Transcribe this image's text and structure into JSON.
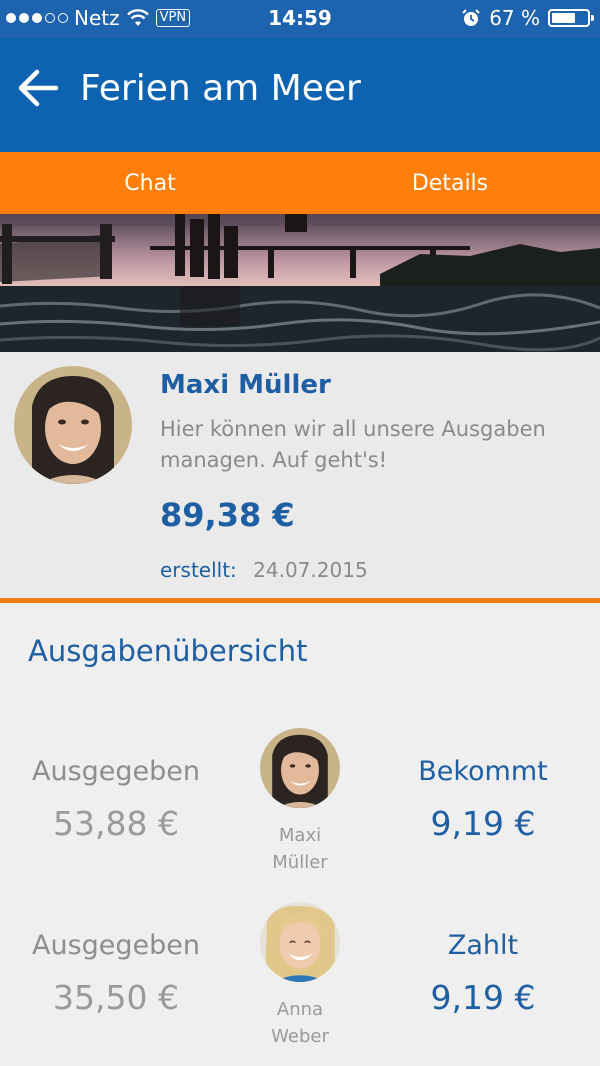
{
  "status_bar": {
    "carrier": "Netz",
    "vpn": "VPN",
    "time": "14:59",
    "battery": "67 %",
    "battery_level": 0.67,
    "signal_dots_filled": 3,
    "signal_dots_total": 5,
    "icons": [
      "wifi-icon",
      "alarm-icon",
      "battery-icon"
    ]
  },
  "app_bar": {
    "title": "Ferien am Meer",
    "back_icon": "arrow-left-icon"
  },
  "tabs": [
    {
      "label": "Chat"
    },
    {
      "label": "Details"
    }
  ],
  "profile": {
    "name": "Maxi Müller",
    "description": "Hier können wir all unsere Ausgaben managen. Auf geht's!",
    "amount": "89,38 €",
    "created_label": "erstellt:",
    "created_date": "24.07.2015"
  },
  "overview": {
    "title": "Ausgabenübersicht",
    "rows": [
      {
        "spent_label": "Ausgegeben",
        "spent_value": "53,88 €",
        "first_name": "Maxi",
        "last_name": "Müller",
        "status_label": "Bekommt",
        "status_value": "9,19 €"
      },
      {
        "spent_label": "Ausgegeben",
        "spent_value": "35,50 €",
        "first_name": "Anna",
        "last_name": "Weber",
        "status_label": "Zahlt",
        "status_value": "9,19 €"
      }
    ]
  },
  "colors": {
    "status_bar": "#1d63ad",
    "app_bar": "#0e63b0",
    "tabs": "#ff7f0a",
    "accent_text": "#1d5fa2",
    "divider": "#f07d16"
  }
}
